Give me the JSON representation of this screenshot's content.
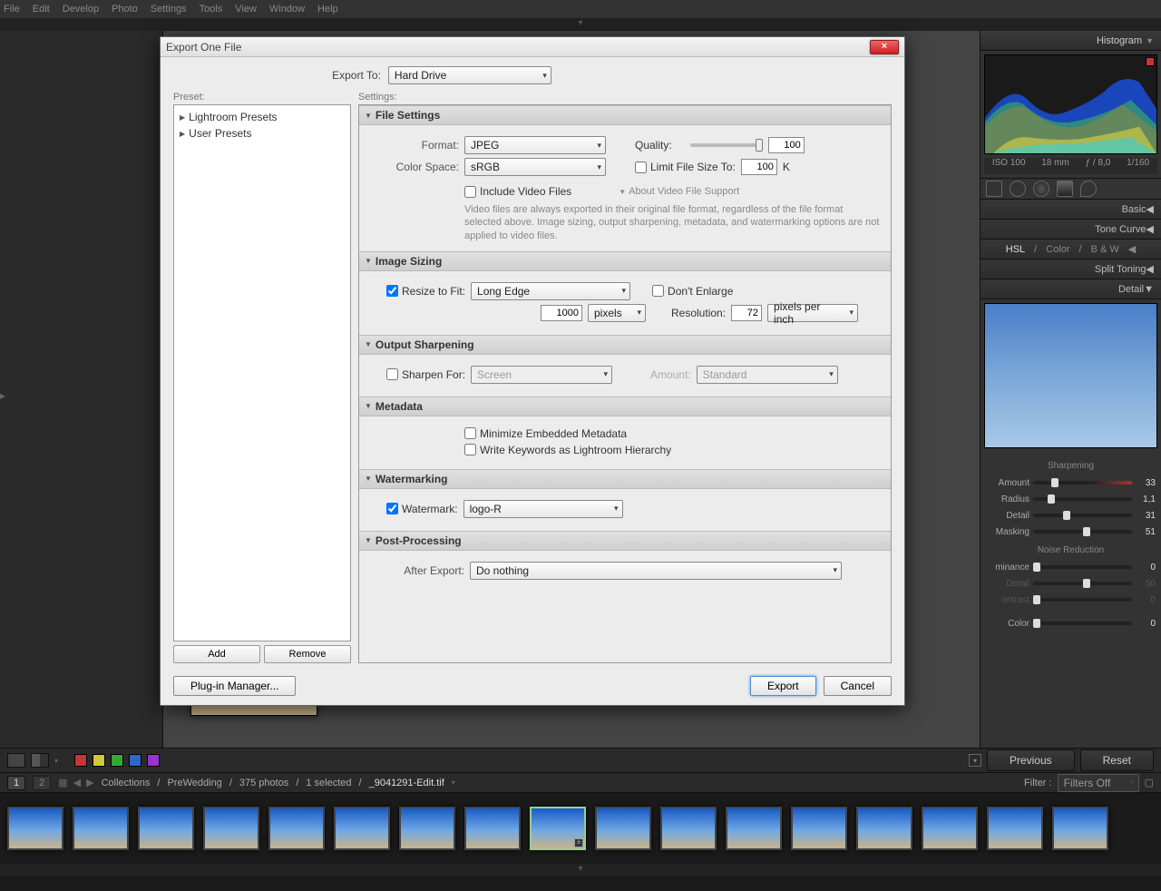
{
  "menu": [
    "File",
    "Edit",
    "Develop",
    "Photo",
    "Settings",
    "Tools",
    "View",
    "Window",
    "Help"
  ],
  "dialog": {
    "title": "Export One File",
    "export_to_label": "Export To:",
    "export_to_value": "Hard Drive",
    "preset_label": "Preset:",
    "settings_label": "Settings:",
    "presets": [
      "Lightroom Presets",
      "User Presets"
    ],
    "add": "Add",
    "remove": "Remove",
    "plugin_mgr": "Plug-in Manager...",
    "export_btn": "Export",
    "cancel_btn": "Cancel",
    "sections": {
      "file_settings": {
        "title": "File Settings",
        "format_label": "Format:",
        "format_value": "JPEG",
        "quality_label": "Quality:",
        "quality_value": "100",
        "colorspace_label": "Color Space:",
        "colorspace_value": "sRGB",
        "limit_label": "Limit File Size To:",
        "limit_value": "100",
        "limit_unit": "K",
        "include_video": "Include Video Files",
        "about_video": "About Video File Support",
        "video_note": "Video files are always exported in their original file format, regardless of the file format selected above. Image sizing, output sharpening, metadata, and watermarking options are not applied to video files."
      },
      "image_sizing": {
        "title": "Image Sizing",
        "resize_label": "Resize to Fit:",
        "resize_value": "Long Edge",
        "dont_enlarge": "Don't Enlarge",
        "size_value": "1000",
        "size_unit": "pixels",
        "resolution_label": "Resolution:",
        "resolution_value": "72",
        "resolution_unit": "pixels per inch"
      },
      "output_sharpening": {
        "title": "Output Sharpening",
        "sharpen_label": "Sharpen For:",
        "sharpen_value": "Screen",
        "amount_label": "Amount:",
        "amount_value": "Standard"
      },
      "metadata": {
        "title": "Metadata",
        "minimize": "Minimize Embedded Metadata",
        "keywords": "Write Keywords as Lightroom Hierarchy"
      },
      "watermarking": {
        "title": "Watermarking",
        "watermark_label": "Watermark:",
        "watermark_value": "logo-R"
      },
      "post_processing": {
        "title": "Post-Processing",
        "after_label": "After Export:",
        "after_value": "Do nothing"
      }
    }
  },
  "right_panel": {
    "histogram": "Histogram",
    "iso": "ISO 100",
    "focal": "18 mm",
    "aperture": "ƒ / 8,0",
    "shutter": "1/160",
    "basic": "Basic",
    "tone_curve": "Tone Curve",
    "hsl": "HSL",
    "color": "Color",
    "bw": "B & W",
    "split_toning": "Split Toning",
    "detail": "Detail",
    "sharpening": "Sharpening",
    "sliders": {
      "amount": {
        "label": "Amount",
        "value": "33",
        "pos": 18
      },
      "radius": {
        "label": "Radius",
        "value": "1,1",
        "pos": 15
      },
      "detail": {
        "label": "Detail",
        "value": "31",
        "pos": 30
      },
      "masking": {
        "label": "Masking",
        "value": "51",
        "pos": 50
      }
    },
    "noise_reduction": "Noise Reduction",
    "nr_sliders": {
      "luminance": {
        "label": "minance",
        "value": "0",
        "pos": 0
      },
      "nr_detail": {
        "label": "Detail",
        "value": "50",
        "pos": 50
      },
      "contrast": {
        "label": "ontrast",
        "value": "0",
        "pos": 0
      },
      "nr_color": {
        "label": "Color",
        "value": "0",
        "pos": 0
      }
    }
  },
  "bottom_buttons": {
    "previous": "Previous",
    "reset": "Reset"
  },
  "crumb": {
    "collections": "Collections",
    "prewedding": "PreWedding",
    "photos": "375 photos",
    "selected": "1 selected",
    "file": "_9041291-Edit.tif",
    "filter_label": "Filter :",
    "filter_value": "Filters Off"
  },
  "colors": {
    "red": "#cc3333",
    "yellow": "#cccc33",
    "green": "#33aa33",
    "blue": "#3366cc",
    "purple": "#9933cc"
  }
}
